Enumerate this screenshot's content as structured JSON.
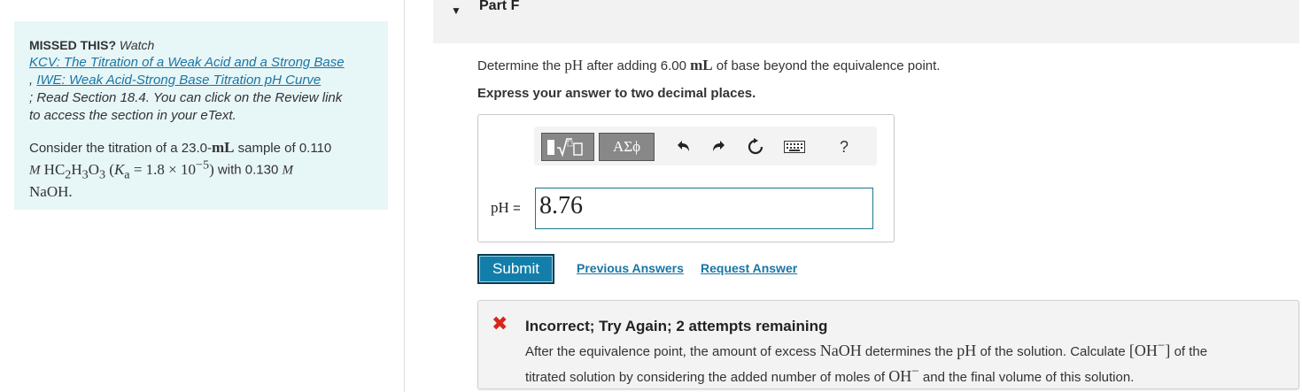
{
  "hint": {
    "missed_label": "MISSED THIS?",
    "watch": "Watch",
    "link1": "KCV: The Titration of a Weak Acid and a Strong Base",
    "comma": ",",
    "link2": "IWE: Weak Acid-Strong Base Titration pH Curve",
    "semicolon": ";",
    "read_text": "Read Section 18.4. You can click on the Review link",
    "read_text2": "to access the section in your eText.",
    "consider_prefix": "Consider the titration of a 23.0-",
    "unit_mL": "mL",
    "sample_of": "sample of 0.110",
    "M": "M",
    "acid": "HC",
    "ka_label": "K",
    "ka_sub": "a",
    "ka_value": "1.8 × 10",
    "ka_exp": "−5",
    "with_text": "with 0.130",
    "base": "NaOH."
  },
  "part": {
    "title": "Part F",
    "caret": "▼"
  },
  "question": {
    "prefix": "Determine the",
    "pH": "pH",
    "middle": "after adding 6.00",
    "unit": "mL",
    "suffix": "of base beyond the equivalence point.",
    "instruction": "Express your answer to two decimal places."
  },
  "toolbar": {
    "symbols_label": "ΑΣϕ",
    "undo_icon": "undo-icon",
    "redo_icon": "redo-icon",
    "reset_icon": "reset-icon",
    "keyboard_icon": "keyboard-icon",
    "help_label": "?"
  },
  "answer": {
    "label": "pH",
    "equals": " =",
    "value": "8.76"
  },
  "actions": {
    "submit": "Submit",
    "previous_answers": "Previous Answers",
    "request_answer": "Request Answer"
  },
  "feedback": {
    "icon": "✖",
    "title": "Incorrect; Try Again; 2 attempts remaining",
    "line1_a": "After the equivalence point, the amount of excess",
    "naoh": "NaOH",
    "line1_b": "determines the",
    "pH": "pH",
    "line1_c": "of the solution. Calculate",
    "oh_bracket": "[OH",
    "oh_minus": "−",
    "oh_close": "]",
    "line1_d": "of the",
    "line2_a": "titrated solution by considering the added number of moles of",
    "oh": "OH",
    "line2_b": "and the final volume of this solution."
  },
  "colors": {
    "hint_bg": "#e7f6f7",
    "link": "#1976a6",
    "submit_bg": "#137eaa",
    "error_red": "#d9261c",
    "input_border": "#1a7a8a"
  }
}
